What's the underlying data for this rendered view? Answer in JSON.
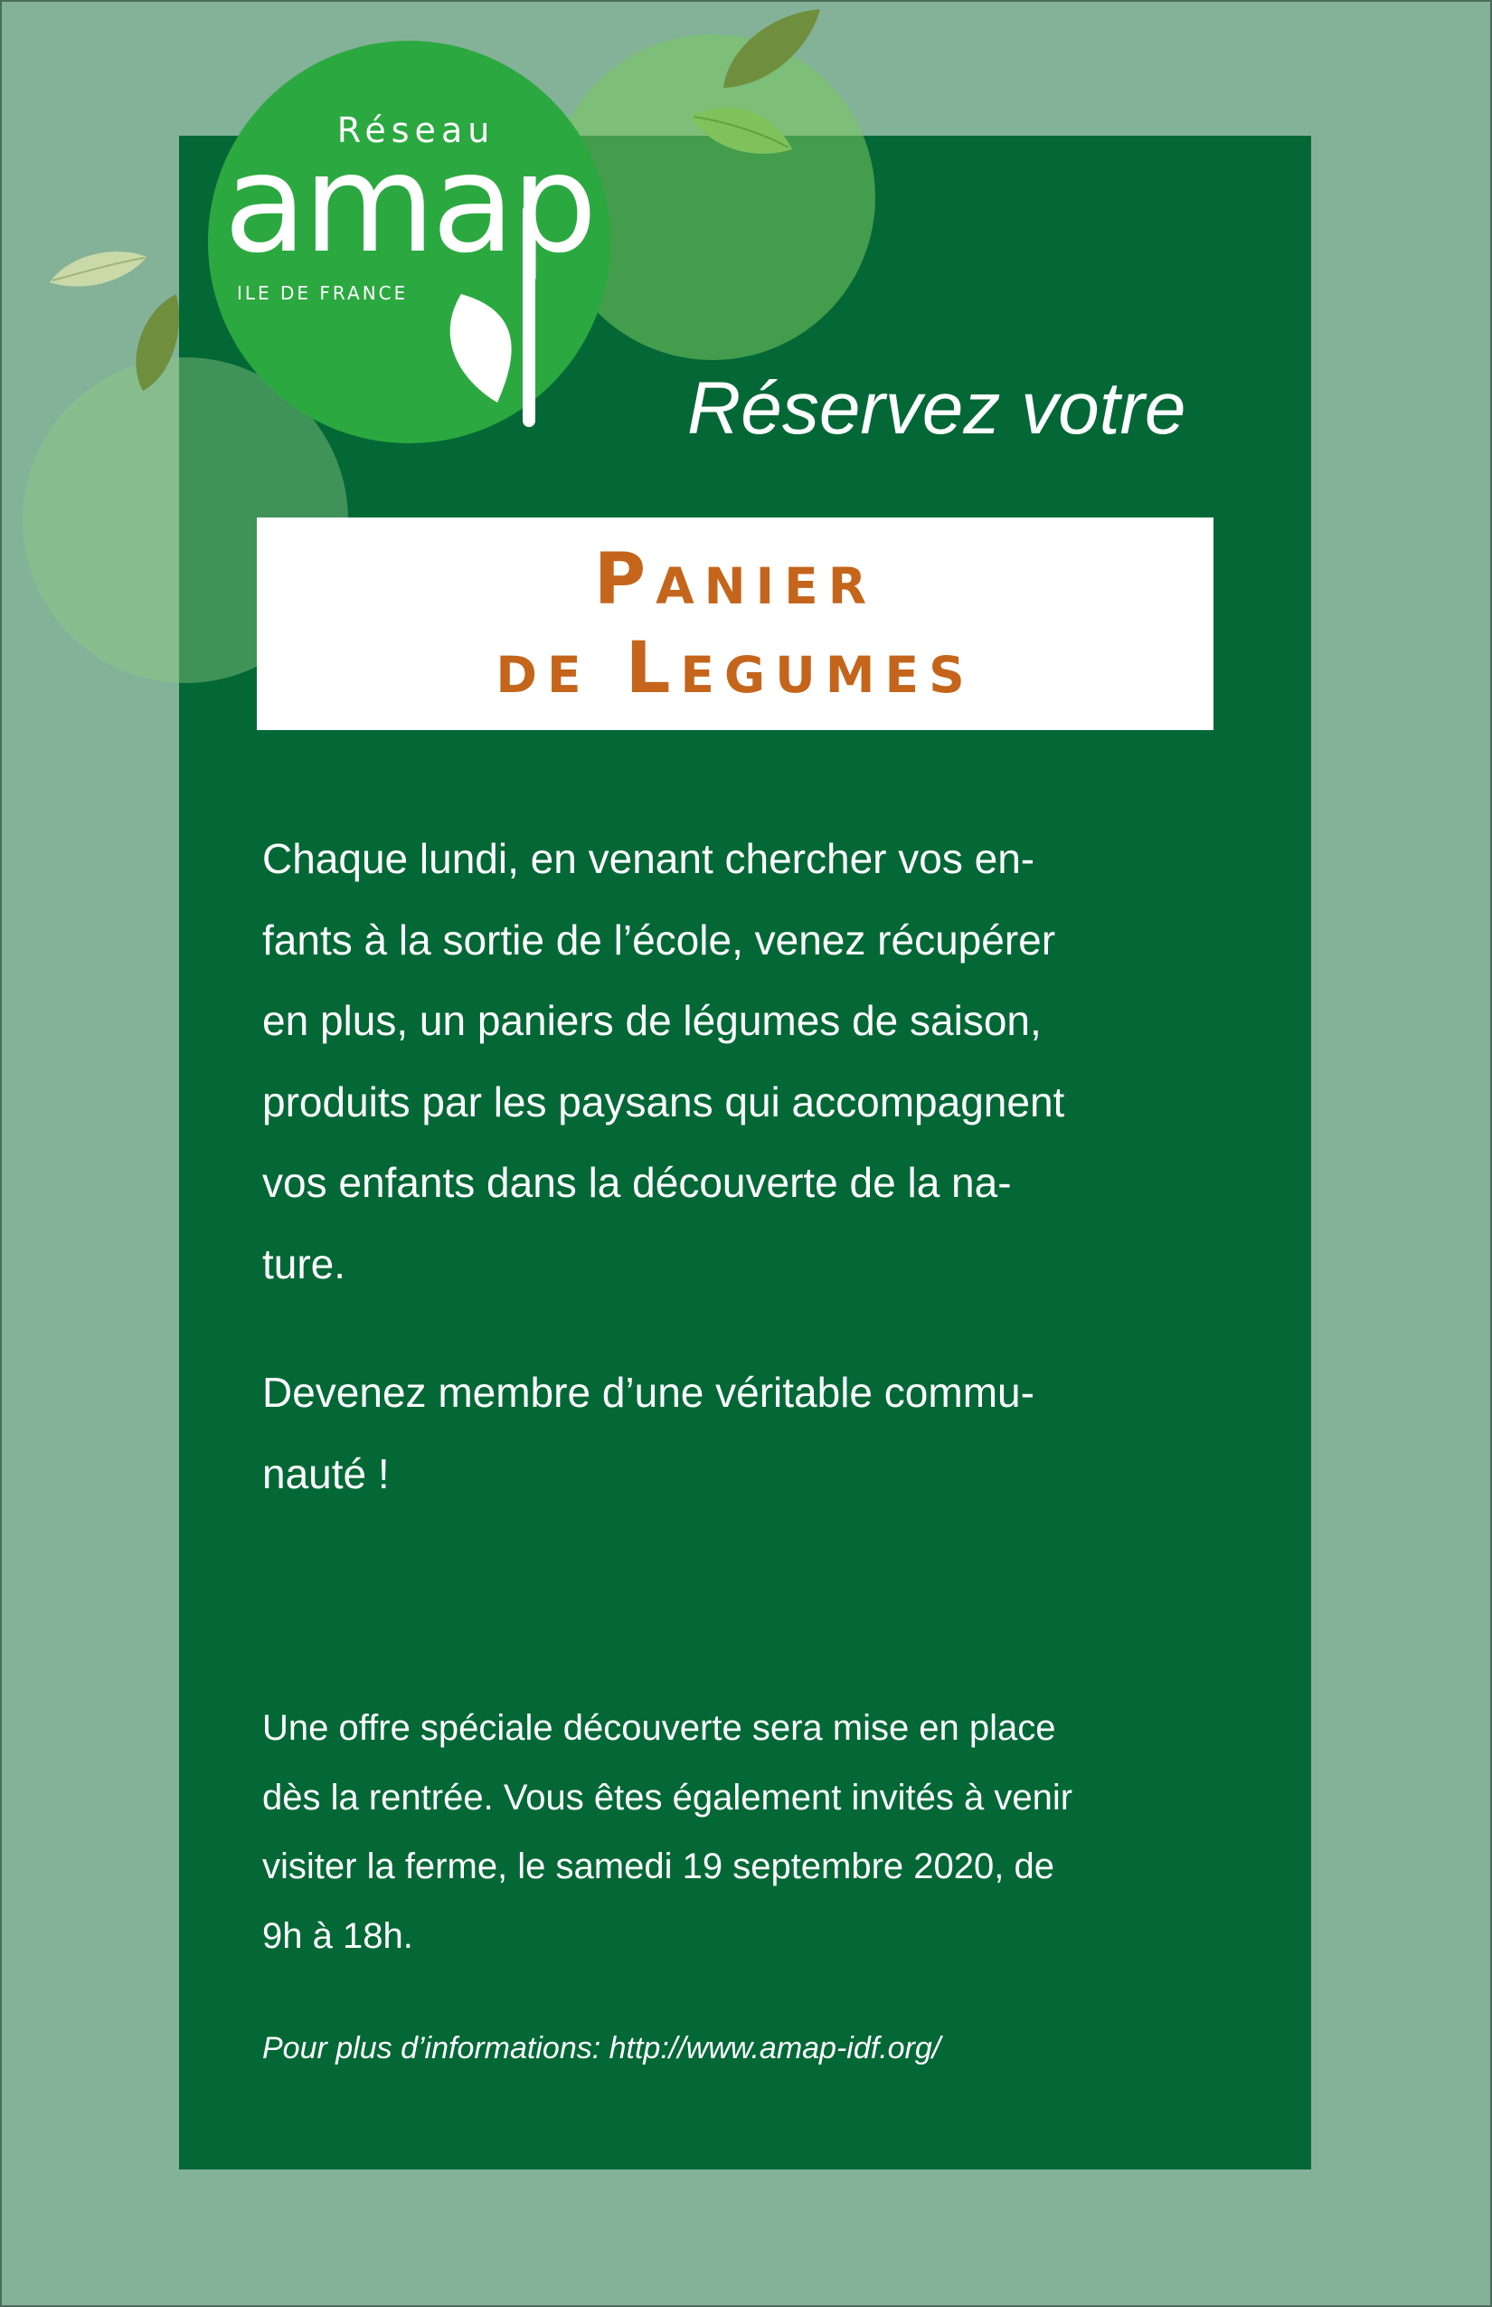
{
  "logo": {
    "network_label": "Réseau",
    "brand": "amap",
    "region": "ILE DE FRANCE"
  },
  "headline": "Réservez votre",
  "title": {
    "line1": "Panier",
    "line2": "de Legumes"
  },
  "paragraph1": [
    "Chaque lundi, en venant chercher vos en-",
    "fants à la sortie de l’école, venez récupérer",
    "en plus, un paniers de légumes de saison,",
    "produits par les paysans qui accompagnent",
    "vos enfants dans la découverte de la na-",
    "ture."
  ],
  "paragraph2": [
    "Devenez membre d’une véritable commu-",
    "nauté !"
  ],
  "paragraph3": [
    "Une offre spéciale découverte sera mise en place",
    "dès la rentrée. Vous êtes également invités à venir",
    "visiter la ferme, le samedi 19 septembre 2020, de",
    "9h à 18h."
  ],
  "info_line": "Pour plus d’informations: http://www.amap-idf.org/",
  "colors": {
    "page_background": "#84b298",
    "panel": "#036836",
    "title_text": "#c4651b",
    "logo_circle": "#2ba940"
  },
  "icons": [
    "leaf-icon",
    "leaf-icon",
    "leaf-icon",
    "leaf-icon"
  ]
}
